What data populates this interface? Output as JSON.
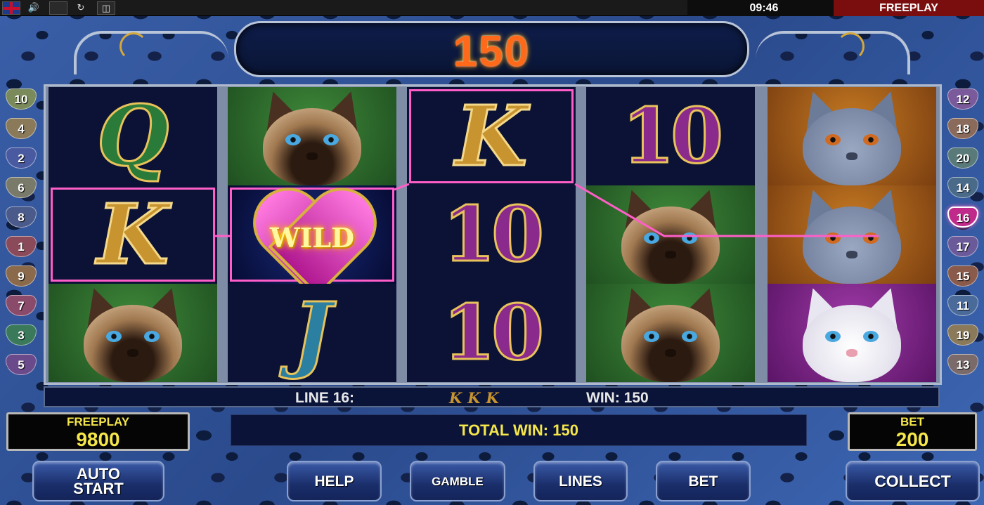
{
  "topbar": {
    "flag_icon": "uk-flag-icon",
    "time": "09:46",
    "mode": "FREEPLAY"
  },
  "header": {
    "win_amount": "150"
  },
  "badges": {
    "left": [
      "10",
      "4",
      "2",
      "6",
      "8",
      "1",
      "9",
      "7",
      "3",
      "5"
    ],
    "right": [
      "12",
      "18",
      "20",
      "14",
      "16",
      "17",
      "15",
      "11",
      "19",
      "13"
    ],
    "active": "16",
    "colors": {
      "10": "#7a8a5a",
      "4": "#8a7a5a",
      "2": "#4a5aa0",
      "6": "#7a7a6a",
      "8": "#4a5a8a",
      "1": "#8a4a5a",
      "9": "#8a6a4a",
      "7": "#8a4a6a",
      "3": "#3a7a5a",
      "5": "#6a4a8a",
      "12": "#7a5a9a",
      "18": "#8a6a5a",
      "20": "#5a7a7a",
      "14": "#4a6a8a",
      "16": "#c02a8a",
      "17": "#6a5a9a",
      "15": "#8a5a4a",
      "11": "#4a6a9a",
      "19": "#8a7a5a",
      "13": "#7a6a6a"
    }
  },
  "reels": [
    [
      "Q",
      "K",
      "siamese-cat"
    ],
    [
      "siamese-cat",
      "WILD",
      "J"
    ],
    [
      "K",
      "10",
      "10"
    ],
    [
      "10",
      "siamese-cat",
      "siamese-cat"
    ],
    [
      "grey-cat",
      "grey-cat",
      "white-cat"
    ]
  ],
  "winline": {
    "label": "LINE 16:",
    "symbols": "KKK",
    "win": "WIN: 150"
  },
  "balance": {
    "freeplay_caption": "FREEPLAY",
    "freeplay_value": "9800",
    "bet_caption": "BET",
    "bet_value": "200",
    "total_win": "TOTAL WIN: 150"
  },
  "buttons": {
    "auto_start": "AUTO START",
    "help": "HELP",
    "gamble": "GAMBLE",
    "lines": "LINES",
    "bet": "BET",
    "collect": "COLLECT"
  },
  "colors": {
    "highlight": "#ff5ec8",
    "win_text": "#ff6a1a",
    "balance_text": "#f5e64a"
  }
}
